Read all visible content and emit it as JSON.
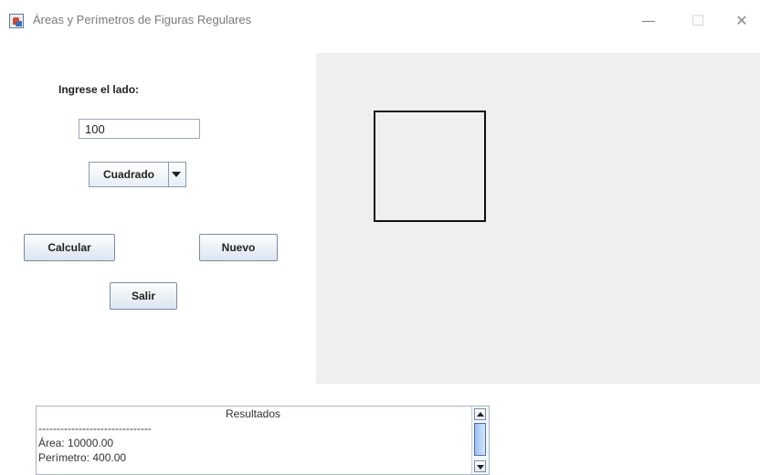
{
  "window": {
    "title": "Áreas y Perímetros de Figuras Regulares",
    "minimize_glyph": "—",
    "maximize_glyph": "☐",
    "close_glyph": "✕"
  },
  "form": {
    "side_label": "Ingrese el lado:",
    "side_value": "100",
    "shape_selected": "Cuadrado",
    "calculate_label": "Calcular",
    "new_label": "Nuevo",
    "exit_label": "Salir"
  },
  "drawing": {
    "shape": "square",
    "stroke_color": "#111111",
    "background_color": "#efefef"
  },
  "results": {
    "lines": [
      "Resultados",
      "-------------------------------",
      "Área: 10000.00",
      "Perímetro: 400.00"
    ]
  },
  "icons": {
    "app": "java-app-icon",
    "combo_arrow": "chevron-down-icon",
    "scroll_up": "arrow-up-icon",
    "scroll_down": "arrow-down-icon"
  }
}
